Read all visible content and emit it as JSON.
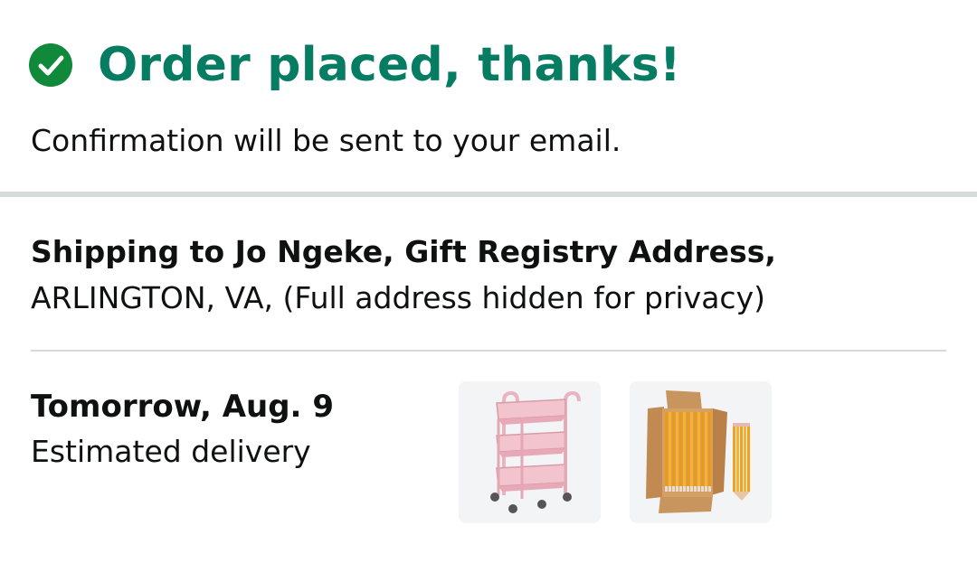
{
  "confirmation": {
    "icon": "check-circle-icon",
    "title": "Order placed, thanks!",
    "subtitle": "Confirmation will be sent to your email.",
    "accent_color": "#067d62",
    "check_color": "#108a3a"
  },
  "shipping": {
    "heading": "Shipping to Jo Ngeke, Gift Registry Address,",
    "address": "ARLINGTON, VA, (Full address hidden for privacy)"
  },
  "delivery": {
    "date": "Tomorrow, Aug. 9",
    "label": "Estimated delivery",
    "items": [
      {
        "icon": "pink-rolling-cart-image"
      },
      {
        "icon": "box-of-pencils-image"
      }
    ]
  }
}
